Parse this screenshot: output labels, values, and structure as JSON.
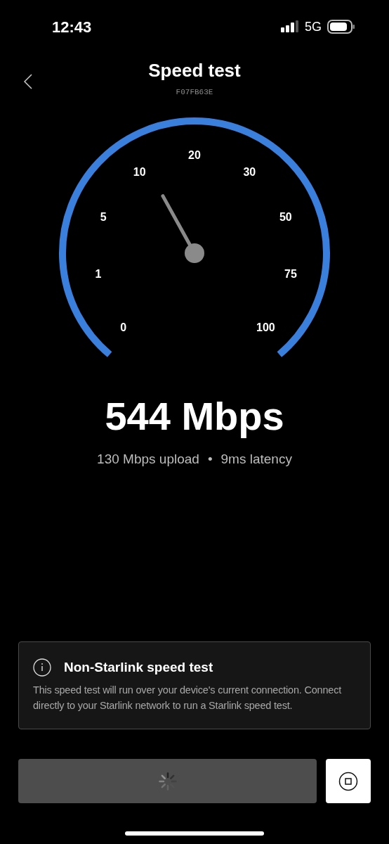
{
  "status_bar": {
    "time": "12:43",
    "network": "5G"
  },
  "header": {
    "title": "Speed test",
    "subtitle": "F07FB63E"
  },
  "gauge": {
    "scale_labels": [
      "0",
      "1",
      "5",
      "10",
      "20",
      "30",
      "50",
      "75",
      "100"
    ]
  },
  "result": {
    "download": "544 Mbps",
    "upload": "130 Mbps upload",
    "separator": "•",
    "latency": "9ms latency"
  },
  "notice": {
    "title": "Non-Starlink speed test",
    "body": "This speed test will run over your device's current connection. Connect directly to your Starlink network to run a Starlink speed test."
  },
  "start_button": {
    "loading": true
  }
}
